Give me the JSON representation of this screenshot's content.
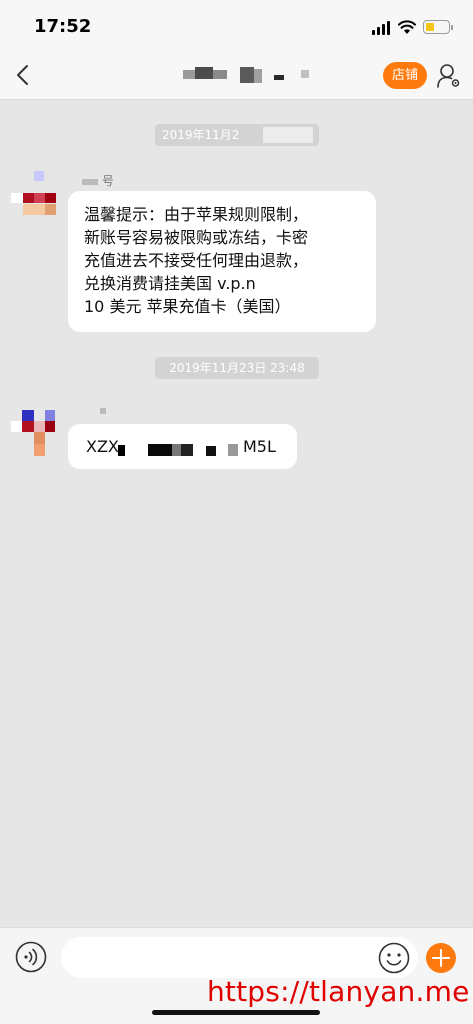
{
  "status_bar": {
    "time": "17:52"
  },
  "nav": {
    "store_label": "店铺"
  },
  "messages": [
    {
      "timestamp": "2019年11月2",
      "sender_suffix": "号",
      "lines": [
        "温馨提示：由于苹果规则限制，",
        "新账号容易被限购或冻结，卡密",
        "充值进去不接受任何理由退款，",
        "兑换消费请挂美国 v.p.n",
        "10 美元 苹果充值卡（美国）"
      ]
    },
    {
      "timestamp": "2019年11月23日 23:48",
      "code_prefix": "XZX",
      "code_suffix": "M5L"
    }
  ],
  "input": {
    "value": "",
    "placeholder": ""
  },
  "watermark": "https://tlanyan.me",
  "colors": {
    "accent": "#ff7a0e",
    "background": "#e6e6e6",
    "watermark": "#e00000"
  }
}
